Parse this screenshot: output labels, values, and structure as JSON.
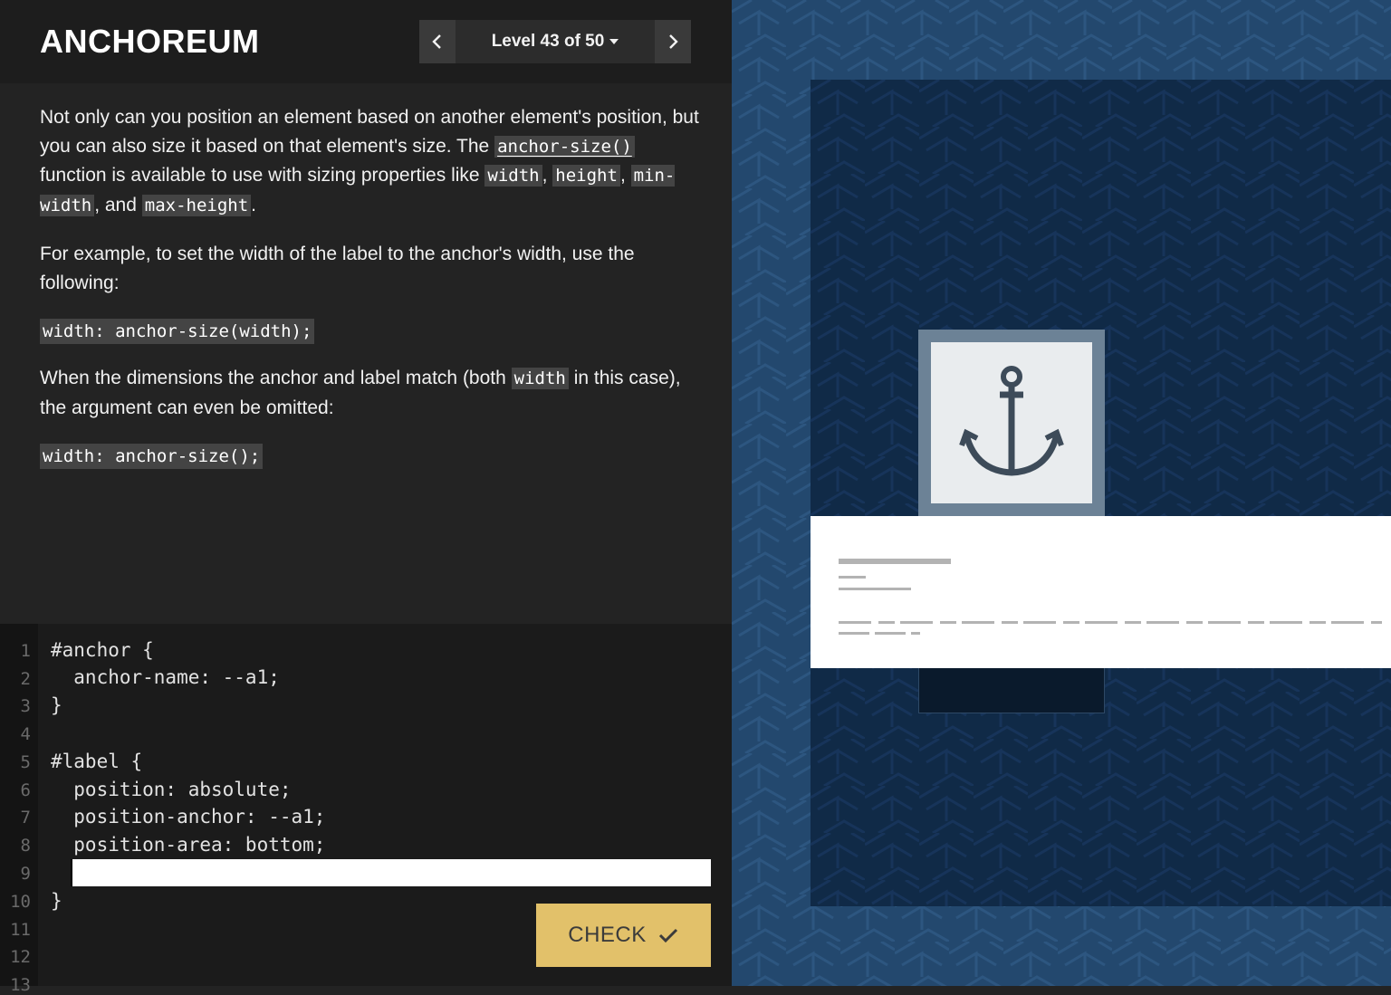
{
  "app": {
    "name": "ANCHOREUM"
  },
  "level_nav": {
    "prev_icon": "chevron-left-icon",
    "next_icon": "chevron-right-icon",
    "label": "Level 43 of 50",
    "dropdown_icon": "caret-down-icon"
  },
  "instructions": {
    "p1_a": "Not only can you position an element based on another element's position, but you can also size it based on that element's size. The ",
    "p1_code_anchor_size": "anchor-size()",
    "p1_b": " function is available to use with sizing properties like ",
    "p1_code_width": "width",
    "p1_c": ", ",
    "p1_code_height": "height",
    "p1_d": ", ",
    "p1_code_min_width": "min-width",
    "p1_e": ", and ",
    "p1_code_max_height": "max-height",
    "p1_f": ".",
    "p2": "For example, to set the width of the label to the anchor's width, use the following:",
    "code1": "width: anchor-size(width);",
    "p3_a": "When the dimensions the anchor and label match (both ",
    "p3_code_width": "width",
    "p3_b": " in this case), the argument can even be omitted:",
    "code2": "width: anchor-size();"
  },
  "editor": {
    "line_numbers": [
      "1",
      "2",
      "3",
      "4",
      "5",
      "6",
      "7",
      "8",
      "9",
      "10",
      "11",
      "12",
      "13"
    ],
    "lines": [
      "#anchor {",
      "  anchor-name: --a1;",
      "}",
      "",
      "#label {",
      "  position: absolute;",
      "  position-anchor: --a1;",
      "  position-area: bottom;",
      "",
      "}"
    ],
    "input_value": "",
    "check_label": "CHECK",
    "check_icon": "checkmark-icon"
  },
  "preview": {
    "anchor_icon": "anchor-icon",
    "colors": {
      "outer_bg": "#23486e",
      "stage_bg": "#102a47",
      "anchor_frame": "#6c8296",
      "anchor_fill": "#e9ecee",
      "label_bg": "#ffffff",
      "check_button": "#e2c16a"
    }
  }
}
